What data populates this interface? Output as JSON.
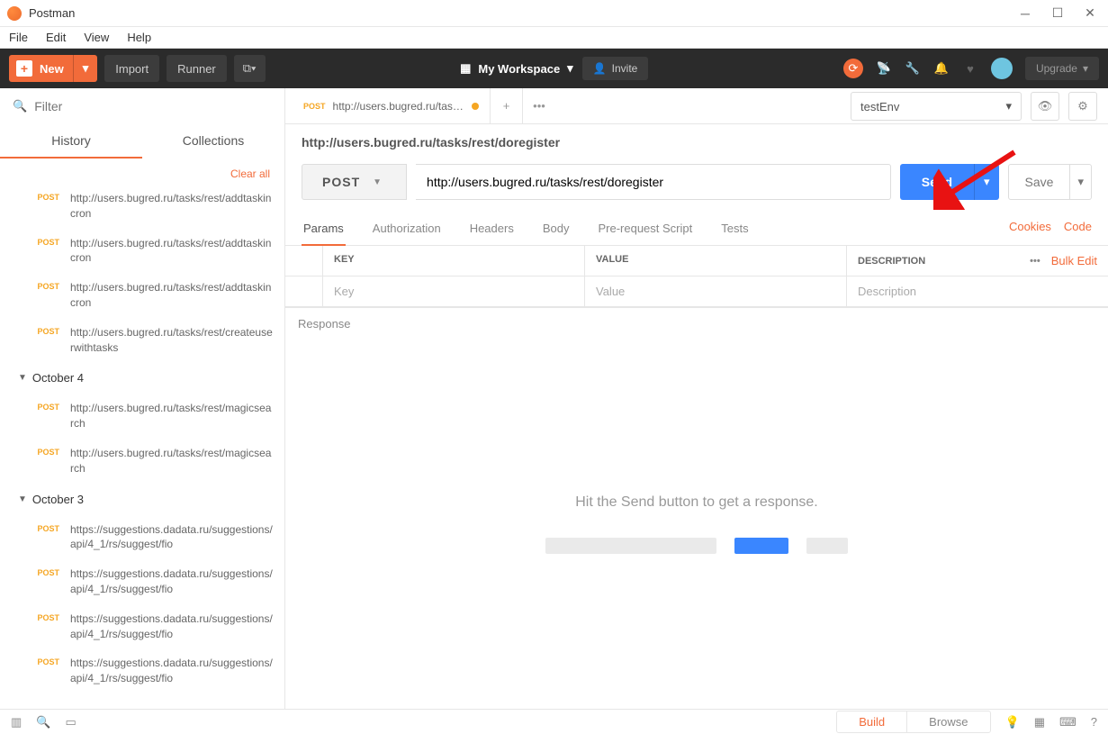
{
  "window": {
    "title": "Postman"
  },
  "menu": {
    "file": "File",
    "edit": "Edit",
    "view": "View",
    "help": "Help"
  },
  "header": {
    "new": "New",
    "import": "Import",
    "runner": "Runner",
    "workspace": "My Workspace",
    "invite": "Invite",
    "upgrade": "Upgrade"
  },
  "sidebar": {
    "filter_placeholder": "Filter",
    "tab_history": "History",
    "tab_collections": "Collections",
    "clear_all": "Clear all",
    "items": [
      {
        "method": "POST",
        "url": "http://users.bugred.ru/tasks/rest/addtaskincron"
      },
      {
        "method": "POST",
        "url": "http://users.bugred.ru/tasks/rest/addtaskincron"
      },
      {
        "method": "POST",
        "url": "http://users.bugred.ru/tasks/rest/addtaskincron"
      },
      {
        "method": "POST",
        "url": "http://users.bugred.ru/tasks/rest/createuserwithtasks"
      }
    ],
    "date1": "October 4",
    "items2": [
      {
        "method": "POST",
        "url": "http://users.bugred.ru/tasks/rest/magicsearch"
      },
      {
        "method": "POST",
        "url": "http://users.bugred.ru/tasks/rest/magicsearch"
      }
    ],
    "date2": "October 3",
    "items3": [
      {
        "method": "POST",
        "url": "https://suggestions.dadata.ru/suggestions/api/4_1/rs/suggest/fio"
      },
      {
        "method": "POST",
        "url": "https://suggestions.dadata.ru/suggestions/api/4_1/rs/suggest/fio"
      },
      {
        "method": "POST",
        "url": "https://suggestions.dadata.ru/suggestions/api/4_1/rs/suggest/fio"
      },
      {
        "method": "POST",
        "url": "https://suggestions.dadata.ru/suggestions/api/4_1/rs/suggest/fio"
      }
    ]
  },
  "tab": {
    "method": "POST",
    "title": "http://users.bugred.ru/tasks/re"
  },
  "env": {
    "selected": "testEnv"
  },
  "request": {
    "title": "http://users.bugred.ru/tasks/rest/doregister",
    "method": "POST",
    "url": "http://users.bugred.ru/tasks/rest/doregister",
    "send": "Send",
    "save": "Save",
    "tabs": {
      "params": "Params",
      "auth": "Authorization",
      "headers": "Headers",
      "body": "Body",
      "prereq": "Pre-request Script",
      "tests": "Tests"
    },
    "cookies": "Cookies",
    "code": "Code",
    "grid": {
      "key": "KEY",
      "value": "VALUE",
      "desc": "DESCRIPTION",
      "bulk": "Bulk Edit",
      "key_ph": "Key",
      "value_ph": "Value",
      "desc_ph": "Description"
    }
  },
  "response": {
    "label": "Response",
    "hint": "Hit the Send button to get a response."
  },
  "status": {
    "build": "Build",
    "browse": "Browse"
  }
}
